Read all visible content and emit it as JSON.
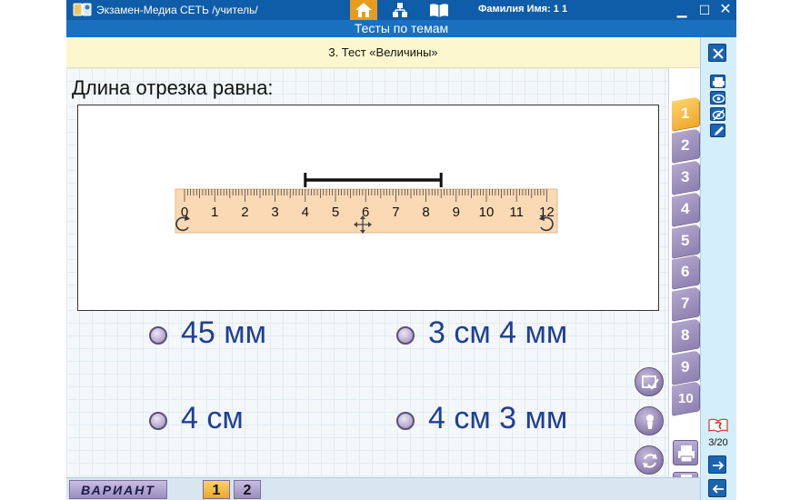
{
  "window": {
    "title": "Экзамен-Медиа СЕТЬ /учитель/",
    "user_label": "Фамилия Имя:   1 1",
    "controls": [
      "minimize",
      "maximize",
      "close"
    ],
    "accent_color": "#e89c1c",
    "bar_color": "#0f5ca8"
  },
  "section": {
    "title": "Тесты по темам"
  },
  "test": {
    "title": "3. Тест «Величины»"
  },
  "question": {
    "prompt": "Длина отрезка равна:",
    "ruler_labels": [
      "0",
      "1",
      "2",
      "3",
      "4",
      "5",
      "6",
      "7",
      "8",
      "9",
      "10",
      "11",
      "12"
    ],
    "segment_start": 4,
    "segment_end": 8.5
  },
  "answers": [
    {
      "text": "45 мм"
    },
    {
      "text": "3 см 4 мм"
    },
    {
      "text": "4 см"
    },
    {
      "text": "4 см 3 мм"
    }
  ],
  "tabs": [
    "1",
    "2",
    "3",
    "4",
    "5",
    "6",
    "7",
    "8",
    "9",
    "10"
  ],
  "active_tab": 1,
  "progress": {
    "text": "3/20"
  },
  "bottom": {
    "variant_label": "ВАРИАНТ",
    "variants": [
      "1",
      "2"
    ],
    "active_variant": 1
  },
  "icons": {
    "nav": [
      "home-icon",
      "tree-icon",
      "book-icon"
    ],
    "right_toolbar": [
      "close-icon",
      "print-icon",
      "eye-icon",
      "eye-crossed-icon",
      "pencil-icon",
      "help-book-icon",
      "arrow-right-icon",
      "arrow-left-icon"
    ],
    "side": [
      "check-list-icon",
      "hint-icon",
      "refresh-icon"
    ]
  }
}
